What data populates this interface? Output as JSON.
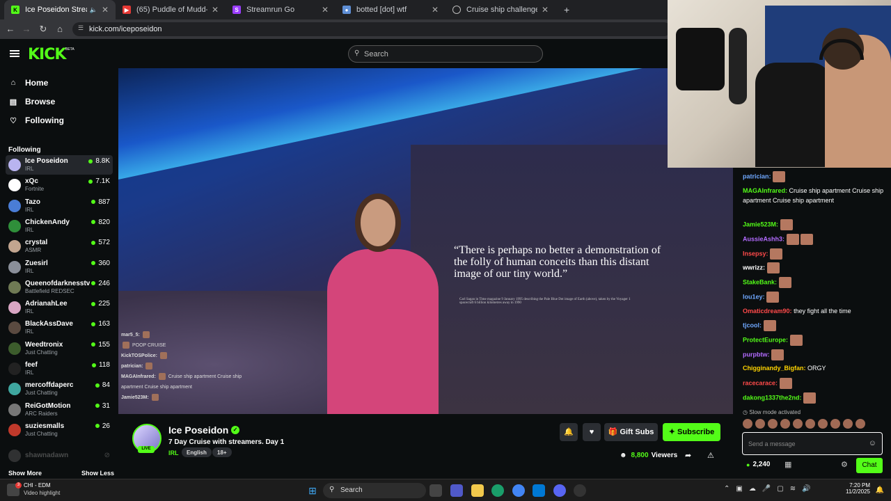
{
  "browser": {
    "tabs": [
      {
        "title": "Ice Poseidon Stream - Watc",
        "active": true,
        "favicon": "kick-icon",
        "muted_icon": "speaker-icon"
      },
      {
        "title": "(65) Puddle of Mudd-Control-L",
        "active": false,
        "favicon": "youtube-icon"
      },
      {
        "title": "Streamrun Go",
        "active": false,
        "favicon": "streamrun-icon"
      },
      {
        "title": "botted [dot] wtf",
        "active": false,
        "favicon": "robot-icon"
      },
      {
        "title": "Cruise ship challenge ideas",
        "active": false,
        "favicon": "globe-icon"
      }
    ],
    "new_tab": "+",
    "url": "kick.com/iceposeidon"
  },
  "header": {
    "logo": "KICK",
    "beta": "BETA",
    "search_placeholder": "Search"
  },
  "sidebar": {
    "nav": [
      {
        "label": "Home",
        "icon": "home-icon"
      },
      {
        "label": "Browse",
        "icon": "browse-icon"
      },
      {
        "label": "Following",
        "icon": "heart-icon"
      }
    ],
    "following_title": "Following",
    "channels": [
      {
        "name": "Ice Poseidon",
        "category": "IRL",
        "viewers": "8.8K",
        "color": "#b9b4f0"
      },
      {
        "name": "xQc",
        "category": "Fortnite",
        "viewers": "7.1K",
        "color": "#ffffff"
      },
      {
        "name": "Tazo",
        "category": "IRL",
        "viewers": "887",
        "color": "#4a7dd6"
      },
      {
        "name": "ChickenAndy",
        "category": "IRL",
        "viewers": "820",
        "color": "#2f8f3a"
      },
      {
        "name": "crystal",
        "category": "ASMR",
        "viewers": "572",
        "color": "#c2a58f"
      },
      {
        "name": "Zuesirl",
        "category": "IRL",
        "viewers": "360",
        "color": "#8a8f99"
      },
      {
        "name": "Queenofdarknesstv",
        "category": "Battlefield REDSEC",
        "viewers": "246",
        "color": "#6f7a54"
      },
      {
        "name": "AdrianahLee",
        "category": "IRL",
        "viewers": "225",
        "color": "#d9a6c4"
      },
      {
        "name": "BlackAssDave",
        "category": "IRL",
        "viewers": "163",
        "color": "#5a4a40"
      },
      {
        "name": "Weedtronix",
        "category": "Just Chatting",
        "viewers": "155",
        "color": "#3c5c2c"
      },
      {
        "name": "feef",
        "category": "IRL",
        "viewers": "118",
        "color": "#222222"
      },
      {
        "name": "mercoffdaperc",
        "category": "Just Chatting",
        "viewers": "84",
        "color": "#3fa7a0"
      },
      {
        "name": "ReiGotMotion",
        "category": "ARC Raiders",
        "viewers": "31",
        "color": "#777777"
      },
      {
        "name": "suziesmalls",
        "category": "Just Chatting",
        "viewers": "26",
        "color": "#c0392b"
      }
    ],
    "offline_channel": "shawnadawn",
    "show_more": "Show More",
    "show_less": "Show Less"
  },
  "video": {
    "quote": "“There is perhaps no better a demonstration of the folly of human conceits than this distant image of our tiny world.”",
    "quote_caption": "Carl Sagan in Time magazine 9 January 1995 describing the Pale Blue Dot image of Earth (above), taken by the Voyager 1 spacecraft 6 billion kilometres away in 1990",
    "overlay_chat": [
      {
        "user": "mar5_5:",
        "text": ""
      },
      {
        "user": "",
        "text": "POOP CRUISE"
      },
      {
        "user": "KickTOSPolice:",
        "text": ""
      },
      {
        "user": "patrician:",
        "text": ""
      },
      {
        "user": "MAGAInfrared:",
        "text": "Cruise ship apartment   Cruise ship apartment   Cruise ship apartment"
      },
      {
        "user": "Jamie523M:",
        "text": ""
      }
    ]
  },
  "stream": {
    "channel_name": "Ice Poseidon",
    "live_badge": "LIVE",
    "title": "7 Day Cruise with streamers. Day 1",
    "category": "IRL",
    "tags": [
      "English",
      "18+"
    ],
    "gift_label": "Gift Subs",
    "subscribe_label": "Subscribe",
    "viewers": "8,800",
    "viewers_label": "Viewers"
  },
  "chat": {
    "messages": [
      {
        "user": "patrician:",
        "color": "#6fa8ff",
        "text": "",
        "emotes": 1
      },
      {
        "user": "MAGAInfrared:",
        "color": "#53fc18",
        "text": "Cruise ship apartment   Cruise ship apartment   Cruise ship apartment",
        "emotes": 0
      },
      {
        "user": "Jamie523M:",
        "color": "#53fc18",
        "text": "",
        "emotes": 1
      },
      {
        "user": "AussieAshh3:",
        "color": "#b36bff",
        "text": "",
        "emotes": 2
      },
      {
        "user": "Insepsy:",
        "color": "#ff4a4a",
        "text": "",
        "emotes": 1
      },
      {
        "user": "wwrizz:",
        "color": "#ffffff",
        "text": "",
        "emotes": 1
      },
      {
        "user": "StakeBank:",
        "color": "#53fc18",
        "text": "",
        "emotes": 1
      },
      {
        "user": "lou1ey:",
        "color": "#6fa8ff",
        "text": "",
        "emotes": 1
      },
      {
        "user": "Omaticdream90:",
        "color": "#ff4a4a",
        "text": "they fight all the time",
        "emotes": 0
      },
      {
        "user": "tjcool:",
        "color": "#6fa8ff",
        "text": "",
        "emotes": 1
      },
      {
        "user": "ProtectEurope:",
        "color": "#53fc18",
        "text": "",
        "emotes": 1
      },
      {
        "user": "purpbtw:",
        "color": "#b36bff",
        "text": "",
        "emotes": 1
      },
      {
        "user": "Chigginandy_Bigfan:",
        "color": "#ffd400",
        "text": "ORGY",
        "emotes": 0
      },
      {
        "user": "racecaracе:",
        "color": "#ff4a4a",
        "text": "",
        "emotes": 1
      },
      {
        "user": "dakong1337the2nd:",
        "color": "#53fc18",
        "text": "",
        "emotes": 1
      }
    ],
    "slow_mode": "Slow mode activated",
    "input_placeholder": "Send a message",
    "points": "2,240",
    "send_label": "Chat"
  },
  "taskbar": {
    "notification_title": "CHI - EDM",
    "notification_sub": "Video highlight",
    "notification_badge": "3",
    "search_label": "Search",
    "time": "7:20 PM",
    "date": "11/2/2025"
  }
}
